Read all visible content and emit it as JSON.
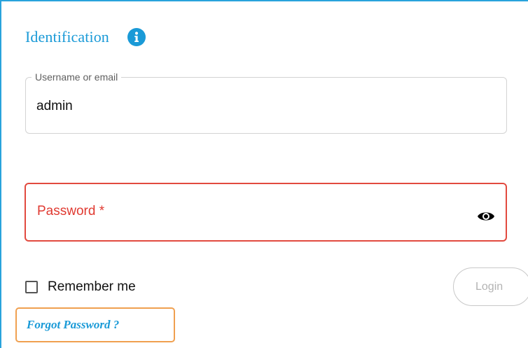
{
  "form": {
    "title": "Identification",
    "info_icon": "info-icon",
    "username": {
      "label": "Username or email",
      "value": "admin"
    },
    "password": {
      "label": "Password *",
      "toggle_icon": "eye-icon"
    },
    "remember_me": {
      "label": "Remember me",
      "checked": false
    },
    "login_label": "Login",
    "forgot_password_label": "Forgot Password ?"
  },
  "colors": {
    "accent": "#1a9ad7",
    "error": "#e03a31",
    "focus_outline": "#f0a050",
    "disabled_text": "#b3b3b3"
  }
}
